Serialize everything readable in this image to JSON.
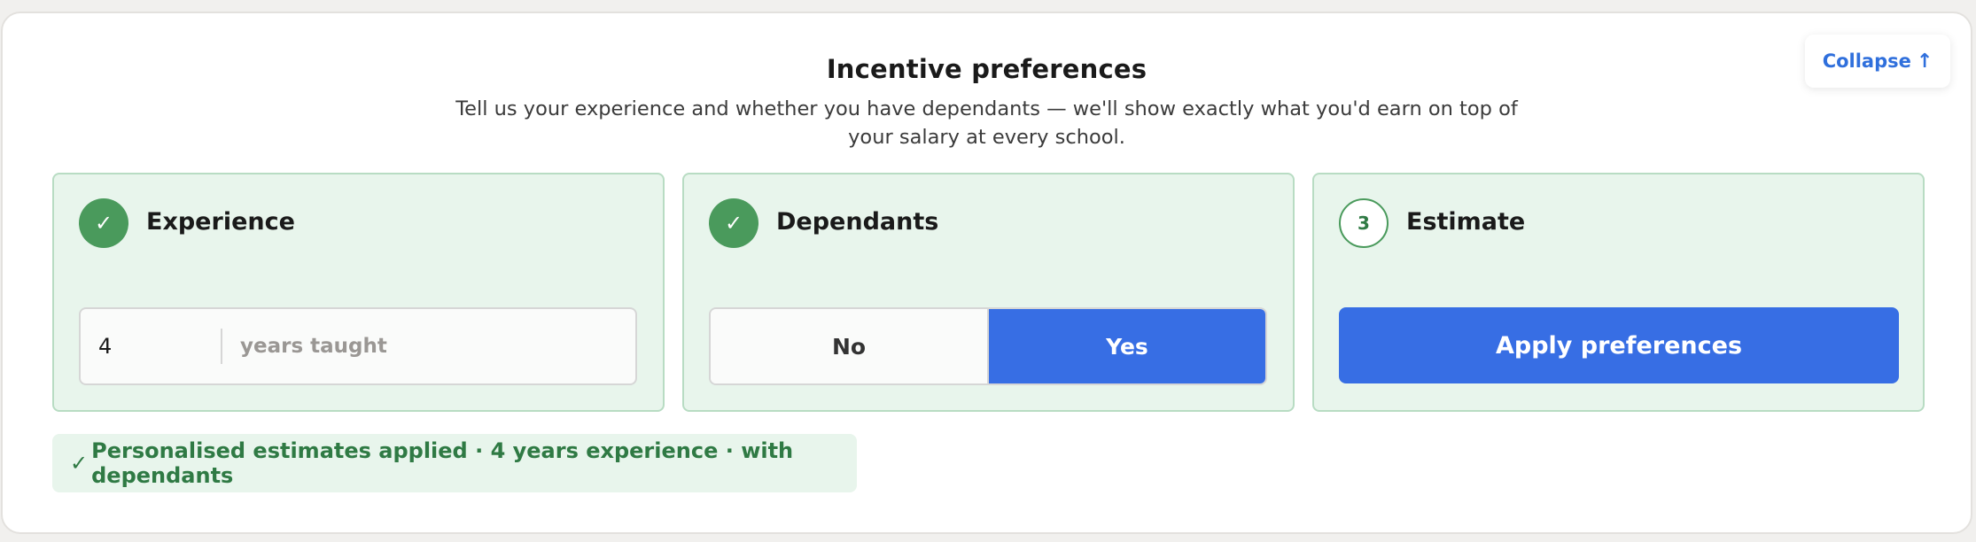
{
  "header": {
    "title": "Incentive preferences",
    "subtitle": "Tell us your experience and whether you have dependants — we'll show exactly what you'd earn on top of your salary at every school."
  },
  "collapse": {
    "label": "Collapse",
    "icon": "↑"
  },
  "steps": [
    {
      "badge": "✓",
      "title": "Experience",
      "status": "complete"
    },
    {
      "badge": "✓",
      "title": "Dependants",
      "status": "complete"
    },
    {
      "badge": "3",
      "title": "Estimate",
      "status": "pending"
    }
  ],
  "experience": {
    "value": "4",
    "unit": "years taught"
  },
  "dependants": {
    "options": [
      "No",
      "Yes"
    ],
    "selected": "Yes"
  },
  "estimate": {
    "button_label": "Apply preferences"
  },
  "status": {
    "icon": "✓",
    "text": "Personalised estimates applied · 4 years experience · with dependants"
  },
  "colors": {
    "accent_blue": "#376ee4",
    "success_green": "#4a9a5c",
    "card_bg": "#e8f5ec",
    "card_border": "#b8dcc3"
  }
}
